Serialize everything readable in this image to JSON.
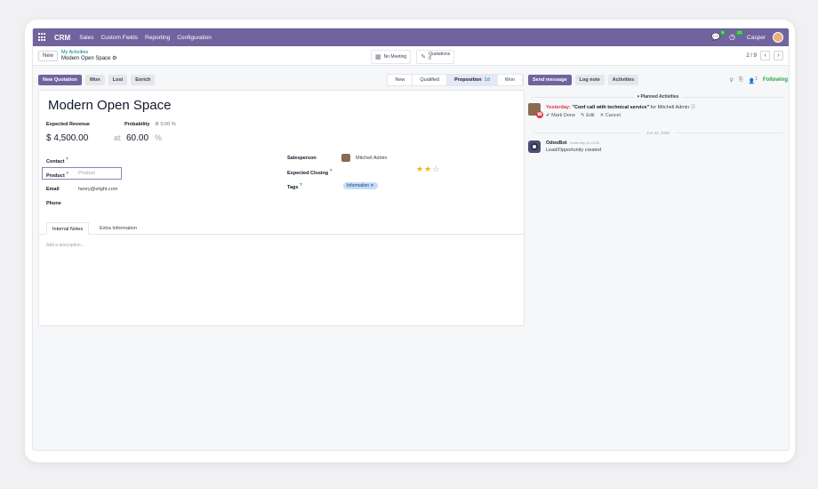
{
  "navbar": {
    "app_name": "CRM",
    "menus": [
      "Sales",
      "Custom Fields",
      "Reporting",
      "Configuration"
    ],
    "messages_count": "5",
    "activities_count": "13",
    "user_name": "Casper"
  },
  "control": {
    "new_label": "New",
    "breadcrumb_parent": "My Activities",
    "breadcrumb_current": "Modern Open Space",
    "meeting_label": "No Meeting",
    "quotations_label": "Quotations",
    "quotations_count": "0",
    "pager": "2 / 9"
  },
  "statusbar": {
    "buttons": [
      "New Quotation",
      "Won",
      "Lost",
      "Enrich"
    ],
    "stages": [
      "New",
      "Qualified",
      "Proposition",
      "Won"
    ],
    "active_stage_days": "1d"
  },
  "form": {
    "title": "Modern Open Space",
    "expected_revenue_label": "Expected Revenue",
    "expected_revenue": "$ 4,500.00",
    "probability_label": "Probability",
    "probability_auto": "0.00 %",
    "at_label": "at",
    "probability_value": "60.00",
    "percent": "%",
    "contact_label": "Contact",
    "product_label": "Product",
    "product_placeholder": "Product",
    "email_label": "Email",
    "email_value": "henry@elight.com",
    "phone_label": "Phone",
    "salesperson_label": "Salesperson",
    "salesperson_value": "Mitchell Admin",
    "expected_closing_label": "Expected Closing",
    "tags_label": "Tags",
    "tag_value": "Information",
    "priority_stars": 2,
    "priority_max": 3,
    "tabs": [
      "Internal Notes",
      "Extra Information"
    ],
    "description_placeholder": "Add a description..."
  },
  "chatter": {
    "send_message": "Send message",
    "log_note": "Log note",
    "activities": "Activities",
    "followers_count": "1",
    "following": "Following",
    "planned_label": "Planned Activities",
    "activity_when": "Yesterday:",
    "activity_summary": "\"Conf call with technical service\"",
    "activity_for": "for Mitchell Admin",
    "mark_done": "Mark Done",
    "edit": "Edit",
    "cancel": "Cancel",
    "date_separator": "Jun 23, 2025",
    "message_author": "OdooBot",
    "message_time": "Yesterday at 13:08",
    "message_body": "Lead/Opportunity created"
  },
  "colors": {
    "brand": "#71639e",
    "accent": "#017e84",
    "overdue": "#dc3545",
    "following": "#28a745",
    "star": "#f3b600"
  }
}
